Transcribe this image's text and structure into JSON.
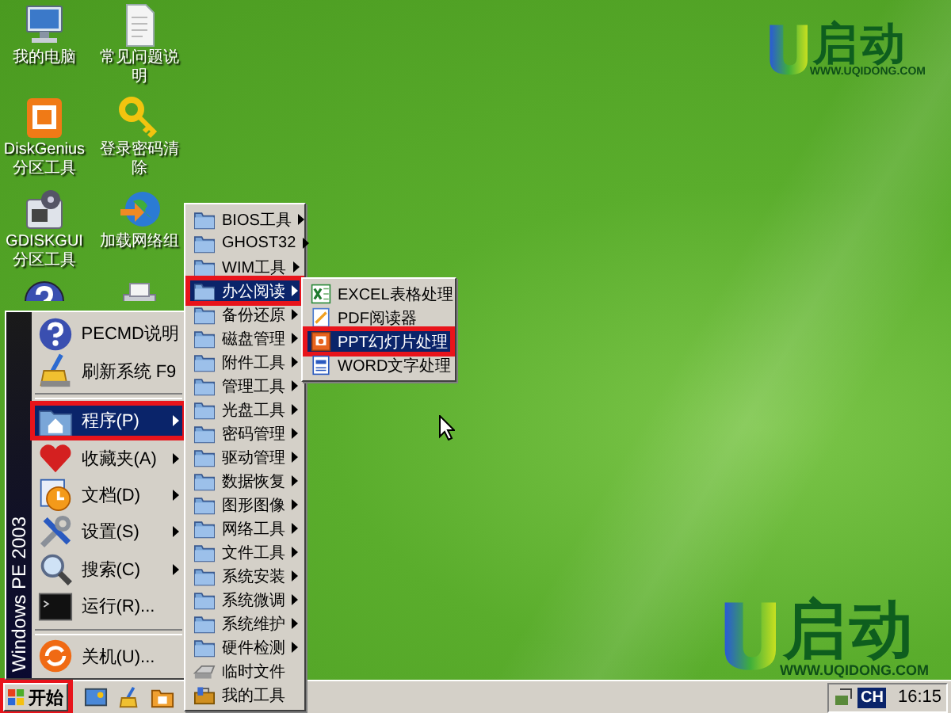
{
  "desktop_icons": [
    {
      "label": "我的电脑",
      "covered": false
    },
    {
      "label": "常见问题说明",
      "covered": false
    },
    {
      "label": "DiskGenius分区工具",
      "covered": false
    },
    {
      "label": "登录密码清除",
      "covered": false
    },
    {
      "label": "GDISKGUI分区工具",
      "covered": false
    },
    {
      "label": "加载网络组",
      "covered": false
    },
    {
      "covered": true
    },
    {
      "covered": true
    }
  ],
  "logos": [
    {
      "brand": "启动",
      "url": "WWW.UQIDONG.COM"
    },
    {
      "brand": "启动",
      "url": "WWW.UQIDONG.COM"
    }
  ],
  "start_menu": {
    "banner": "Windows PE 2003",
    "items": [
      {
        "kind": "item",
        "label": "PECMD说明",
        "has_submenu": false,
        "selected": false,
        "highlighted": false
      },
      {
        "kind": "item",
        "label": "刷新系统 F9",
        "has_submenu": false,
        "selected": false,
        "highlighted": false
      },
      {
        "kind": "separator"
      },
      {
        "kind": "item",
        "label": "程序(P)",
        "has_submenu": true,
        "selected": true,
        "highlighted": true
      },
      {
        "kind": "item",
        "label": "收藏夹(A)",
        "has_submenu": true,
        "selected": false,
        "highlighted": false
      },
      {
        "kind": "item",
        "label": "文档(D)",
        "has_submenu": true,
        "selected": false,
        "highlighted": false
      },
      {
        "kind": "item",
        "label": "设置(S)",
        "has_submenu": true,
        "selected": false,
        "highlighted": false
      },
      {
        "kind": "item",
        "label": "搜索(C)",
        "has_submenu": true,
        "selected": false,
        "highlighted": false
      },
      {
        "kind": "item",
        "label": "运行(R)...",
        "has_submenu": false,
        "selected": false,
        "highlighted": false
      },
      {
        "kind": "separator"
      },
      {
        "kind": "item",
        "label": "关机(U)...",
        "has_submenu": false,
        "selected": false,
        "highlighted": false
      }
    ]
  },
  "programs_menu": {
    "items": [
      {
        "kind": "folder",
        "label": "BIOS工具",
        "selected": false,
        "highlighted": false
      },
      {
        "kind": "folder",
        "label": "GHOST32",
        "selected": false,
        "highlighted": false
      },
      {
        "kind": "folder",
        "label": "WIM工具",
        "selected": false,
        "highlighted": false
      },
      {
        "kind": "folder",
        "label": "办公阅读",
        "selected": true,
        "highlighted": true
      },
      {
        "kind": "folder",
        "label": "备份还原",
        "selected": false,
        "highlighted": false
      },
      {
        "kind": "folder",
        "label": "磁盘管理",
        "selected": false,
        "highlighted": false
      },
      {
        "kind": "folder",
        "label": "附件工具",
        "selected": false,
        "highlighted": false
      },
      {
        "kind": "folder",
        "label": "管理工具",
        "selected": false,
        "highlighted": false
      },
      {
        "kind": "folder",
        "label": "光盘工具",
        "selected": false,
        "highlighted": false
      },
      {
        "kind": "folder",
        "label": "密码管理",
        "selected": false,
        "highlighted": false
      },
      {
        "kind": "folder",
        "label": "驱动管理",
        "selected": false,
        "highlighted": false
      },
      {
        "kind": "folder",
        "label": "数据恢复",
        "selected": false,
        "highlighted": false
      },
      {
        "kind": "folder",
        "label": "图形图像",
        "selected": false,
        "highlighted": false
      },
      {
        "kind": "folder",
        "label": "网络工具",
        "selected": false,
        "highlighted": false
      },
      {
        "kind": "folder",
        "label": "文件工具",
        "selected": false,
        "highlighted": false
      },
      {
        "kind": "folder",
        "label": "系统安装",
        "selected": false,
        "highlighted": false
      },
      {
        "kind": "folder",
        "label": "系统微调",
        "selected": false,
        "highlighted": false
      },
      {
        "kind": "folder",
        "label": "系统维护",
        "selected": false,
        "highlighted": false
      },
      {
        "kind": "folder",
        "label": "硬件检测",
        "selected": false,
        "highlighted": false
      },
      {
        "kind": "program",
        "label": "临时文件",
        "selected": false,
        "highlighted": false
      },
      {
        "kind": "program",
        "label": "我的工具",
        "selected": false,
        "highlighted": false
      }
    ]
  },
  "office_menu": {
    "items": [
      {
        "label": "EXCEL表格处理",
        "selected": false,
        "highlighted": false
      },
      {
        "label": "PDF阅读器",
        "selected": false,
        "highlighted": false
      },
      {
        "label": "PPT幻灯片处理",
        "selected": true,
        "highlighted": true
      },
      {
        "label": "WORD文字处理",
        "selected": false,
        "highlighted": false
      }
    ]
  },
  "taskbar": {
    "start_button": {
      "label": "开始",
      "highlighted": true
    },
    "language": "CH",
    "clock": "16:15"
  }
}
